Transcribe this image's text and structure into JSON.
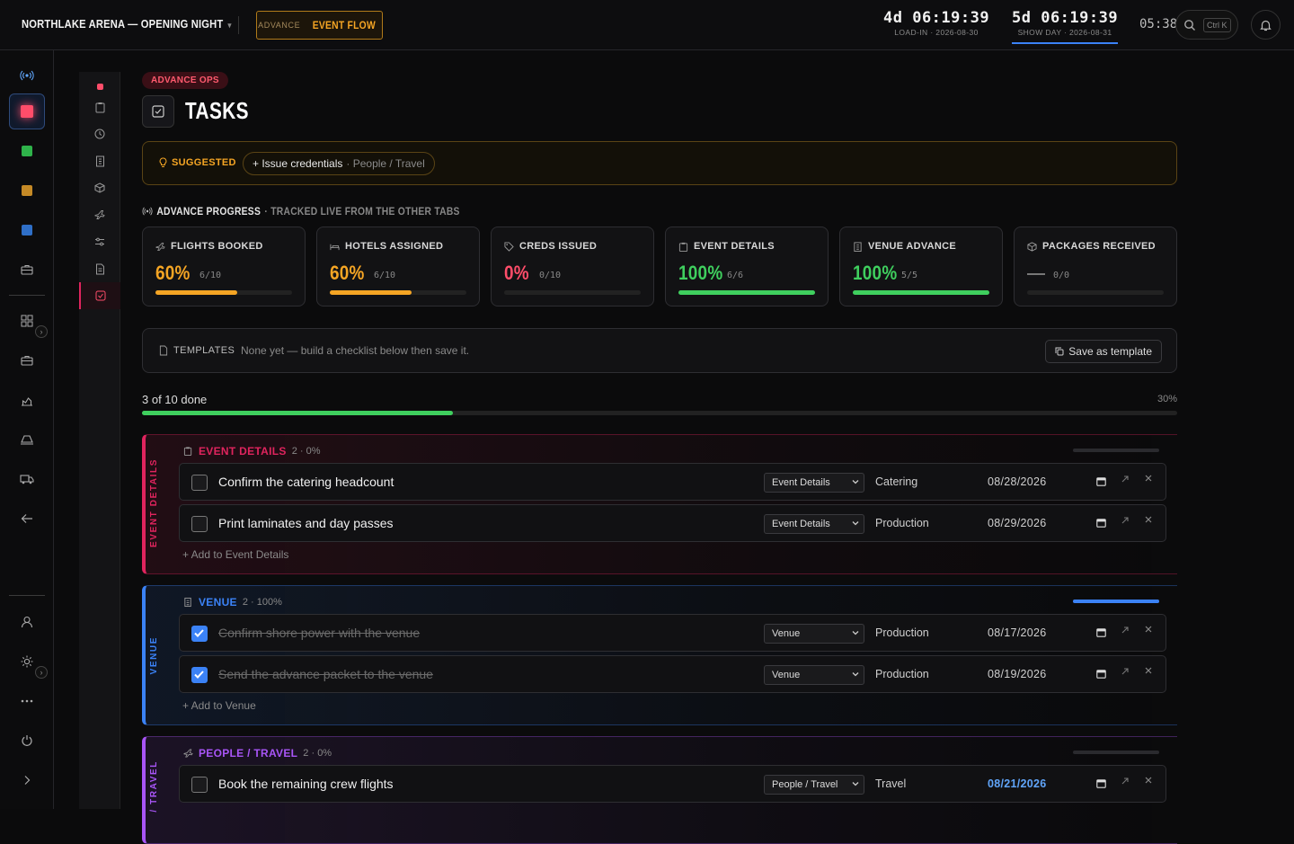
{
  "header": {
    "venue_title": "NORTHLAKE ARENA — OPENING NIGHT",
    "caret": "▾",
    "flow_small": "ADVANCE",
    "flow_big": "EVENT FLOW",
    "countdowns": [
      {
        "value": "4d 06:19:39",
        "label": "LOAD-IN · 2026-08-30"
      },
      {
        "value": "5d 06:19:39",
        "label": "SHOW DAY · 2026-08-31"
      }
    ],
    "clock": "05:38",
    "search_shortcut": "Ctrl K"
  },
  "page": {
    "section_pill": "ADVANCE OPS",
    "title": "TASKS"
  },
  "suggested": {
    "label": "SUGGESTED",
    "chip_main": "+ Issue credentials",
    "chip_meta": "· People / Travel"
  },
  "progress": {
    "heading": "ADVANCE PROGRESS",
    "subheading": "· TRACKED LIVE FROM THE OTHER TABS",
    "cards": [
      {
        "label": "FLIGHTS BOOKED",
        "pct": "60%",
        "count": "6/10",
        "fraction": 0.6,
        "color": "#f5a524",
        "icon": "plane-icon"
      },
      {
        "label": "HOTELS ASSIGNED",
        "pct": "60%",
        "count": "6/10",
        "fraction": 0.6,
        "color": "#f5a524",
        "icon": "bed-icon"
      },
      {
        "label": "CREDS ISSUED",
        "pct": "0%",
        "count": "0/10",
        "fraction": 0,
        "color": "#ff4d6a",
        "icon": "tag-icon"
      },
      {
        "label": "EVENT DETAILS",
        "pct": "100%",
        "count": "6/6",
        "fraction": 1,
        "color": "#3fcf5e",
        "icon": "clipboard-icon"
      },
      {
        "label": "VENUE ADVANCE",
        "pct": "100%",
        "count": "5/5",
        "fraction": 1,
        "color": "#3fcf5e",
        "icon": "building-icon"
      },
      {
        "label": "PACKAGES RECEIVED",
        "pct": "",
        "count": "0/0",
        "fraction": 0,
        "color": "#777777",
        "icon": "box-icon"
      }
    ]
  },
  "templates": {
    "label": "TEMPLATES",
    "text": "None yet — build a checklist below then save it.",
    "save_label": "Save as template"
  },
  "overall": {
    "done_text": "3 of 10 done",
    "pct_text": "30%",
    "fraction": 0.3
  },
  "sections": [
    {
      "name": "EVENT DETAILS",
      "vertical": "EVENT DETAILS",
      "meta": "2 · 0%",
      "fraction": 0,
      "color": "#e0245e",
      "add": "+ Add to Event Details",
      "rows": [
        {
          "title": "Confirm the catering headcount",
          "done": false,
          "select": "Event Details",
          "category": "Catering",
          "date": "08/28/2026",
          "date_highlight": false
        },
        {
          "title": "Print laminates and day passes",
          "done": false,
          "select": "Event Details",
          "category": "Production",
          "date": "08/29/2026",
          "date_highlight": false
        }
      ]
    },
    {
      "name": "VENUE",
      "vertical": "VENUE",
      "meta": "2 · 100%",
      "fraction": 1,
      "color": "#3b82f6",
      "add": "+ Add to Venue",
      "rows": [
        {
          "title": "Confirm shore power with the venue",
          "done": true,
          "select": "Venue",
          "category": "Production",
          "date": "08/17/2026",
          "date_highlight": false
        },
        {
          "title": "Send the advance packet to the venue",
          "done": true,
          "select": "Venue",
          "category": "Production",
          "date": "08/19/2026",
          "date_highlight": false
        }
      ]
    },
    {
      "name": "PEOPLE / TRAVEL",
      "vertical": "/ TRAVEL",
      "meta": "2 · 0%",
      "fraction": 0,
      "color": "#a855f7",
      "add": "",
      "rows": [
        {
          "title": "Book the remaining crew flights",
          "done": false,
          "select": "People / Travel",
          "category": "Travel",
          "date": "08/21/2026",
          "date_highlight": true
        }
      ]
    }
  ]
}
